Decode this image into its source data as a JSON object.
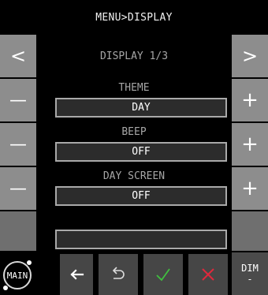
{
  "header": {
    "title": "MENU>DISPLAY"
  },
  "pager": {
    "label": "DISPLAY 1/3",
    "prev_label": "<",
    "next_label": ">"
  },
  "settings": [
    {
      "label": "THEME",
      "value": "DAY"
    },
    {
      "label": "BEEP",
      "value": "OFF"
    },
    {
      "label": "DAY SCREEN",
      "value": "OFF"
    },
    {
      "label": "",
      "value": ""
    }
  ],
  "controls": {
    "minus_label": "—",
    "plus_label": "+"
  },
  "footer": {
    "main_label": "MAIN",
    "back_icon": "arrow-left-icon",
    "undo_icon": "undo-icon",
    "confirm_icon": "checkmark-icon",
    "cancel_icon": "x-icon",
    "dim_label": "DIM",
    "dim_value": "-"
  },
  "colors": {
    "background": "#000000",
    "button": "#8d8d8d",
    "footer_button": "#464646",
    "confirm": "#3fbf3f",
    "cancel": "#e0283c",
    "value_border": "#a9a9a9"
  }
}
